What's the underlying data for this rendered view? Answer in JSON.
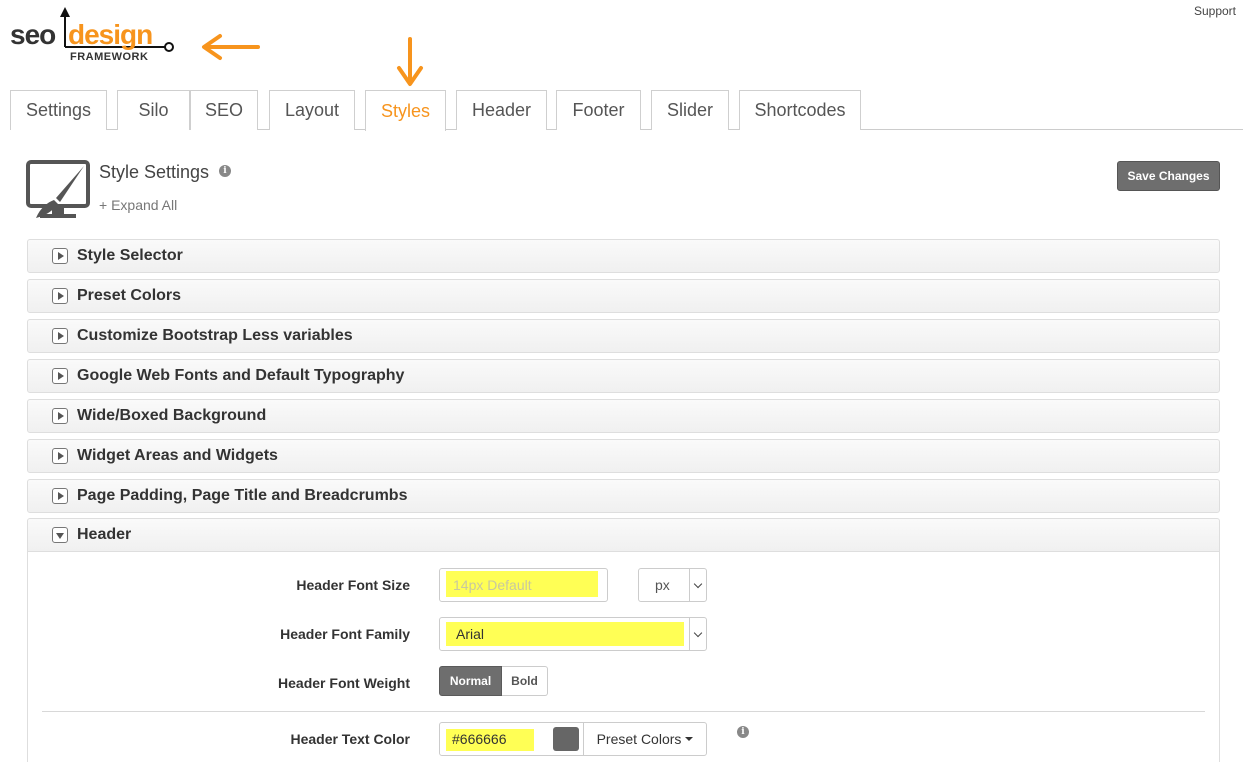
{
  "header": {
    "support": "Support",
    "logo": {
      "seo": "seo",
      "design": "design",
      "framework": "FRAMEWORK"
    }
  },
  "tabs": [
    {
      "label": "Settings"
    },
    {
      "label": "Silo"
    },
    {
      "label": "SEO"
    },
    {
      "label": "Layout"
    },
    {
      "label": "Styles",
      "active": true
    },
    {
      "label": "Header"
    },
    {
      "label": "Footer"
    },
    {
      "label": "Slider"
    },
    {
      "label": "Shortcodes"
    }
  ],
  "page": {
    "title": "Style Settings",
    "expand_all": "+ Expand All",
    "save": "Save Changes",
    "icon": "monitor-brush-icon"
  },
  "sections": [
    {
      "label": "Style Selector",
      "expanded": false
    },
    {
      "label": "Preset Colors",
      "expanded": false
    },
    {
      "label": "Customize Bootstrap Less variables",
      "expanded": false
    },
    {
      "label": "Google Web Fonts and Default Typography",
      "expanded": false
    },
    {
      "label": "Wide/Boxed Background",
      "expanded": false
    },
    {
      "label": "Widget Areas and Widgets",
      "expanded": false
    },
    {
      "label": "Page Padding, Page Title and Breadcrumbs",
      "expanded": false
    },
    {
      "label": "Header",
      "expanded": true
    }
  ],
  "header_settings": {
    "font_size_label": "Header Font Size",
    "font_size_placeholder": "14px Default",
    "unit": "px",
    "font_family_label": "Header Font Family",
    "font_family_value": "Arial",
    "font_weight_label": "Header Font Weight",
    "weight_normal": "Normal",
    "weight_bold": "Bold",
    "weight_selected": "Normal",
    "text_color_label": "Header Text Color",
    "text_color_value": "#666666",
    "preset_colors": "Preset Colors"
  },
  "colors": {
    "accent": "#f7941d",
    "highlight": "#ffff55",
    "swatch": "#666666",
    "button_dark": "#6e6e6e"
  }
}
